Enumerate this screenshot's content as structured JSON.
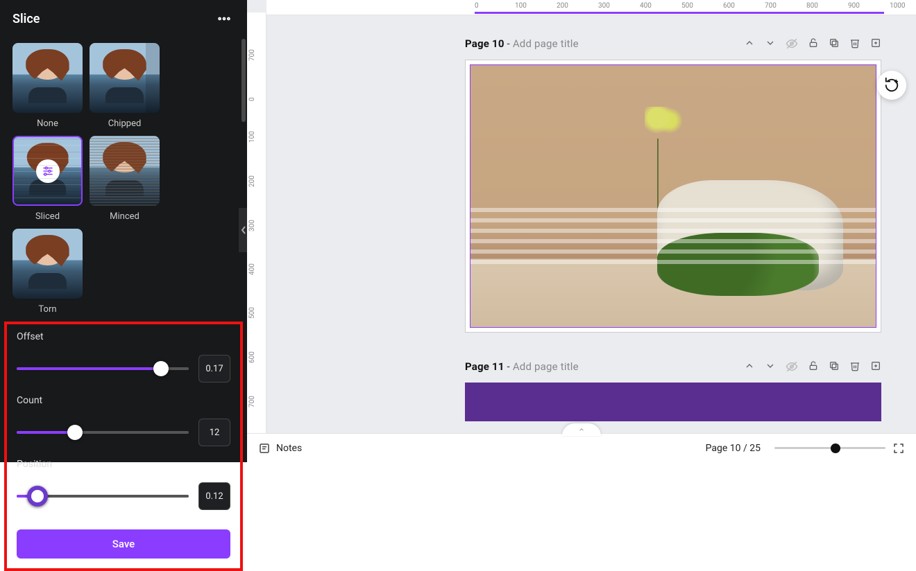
{
  "panel": {
    "title": "Slice",
    "options": [
      {
        "label": "None"
      },
      {
        "label": "Chipped"
      },
      {
        "label": "Sliced",
        "selected": true
      },
      {
        "label": "Minced"
      },
      {
        "label": "Torn"
      }
    ],
    "sliders": {
      "offset": {
        "label": "Offset",
        "value": "0.17",
        "percent": 84
      },
      "count": {
        "label": "Count",
        "value": "12",
        "percent": 34
      },
      "position": {
        "label": "Position",
        "value": "0.12",
        "percent": 12
      }
    },
    "save_label": "Save"
  },
  "rulers": {
    "h": [
      "0",
      "100",
      "200",
      "300",
      "400",
      "500",
      "600",
      "700",
      "800",
      "900",
      "1000"
    ],
    "v": [
      "0",
      "100",
      "200",
      "300",
      "400",
      "500",
      "600",
      "700",
      "700"
    ]
  },
  "pages": [
    {
      "prefix": "Page 10",
      "dash": " - ",
      "placeholder": "Add page title"
    },
    {
      "prefix": "Page 11",
      "dash": " - ",
      "placeholder": "Add page title"
    }
  ],
  "footer": {
    "notes": "Notes",
    "counter": "Page 10 / 25"
  },
  "icons": {
    "more": "more-horizontal",
    "settings": "sliders"
  }
}
